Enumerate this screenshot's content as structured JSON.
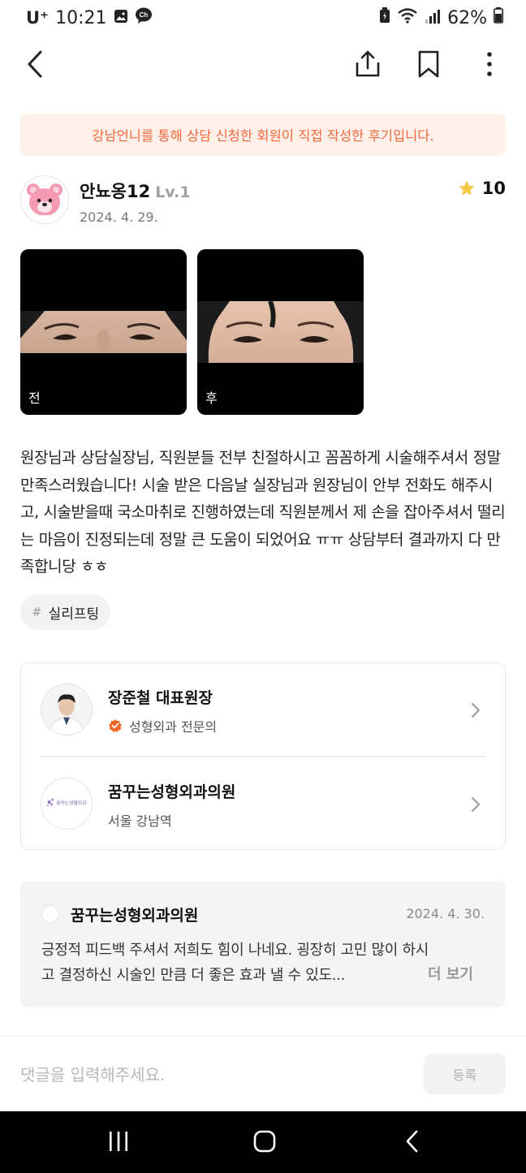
{
  "status_bar": {
    "carrier": "U⁺",
    "time": "10:21",
    "battery": "62%"
  },
  "notice": "강남언니를 통해 상담 신청한 회원이 직접 작성한 후기입니다.",
  "author": {
    "name": "안뇨옹12",
    "level": "Lv.1",
    "date": "2024. 4. 29.",
    "rating": "10"
  },
  "photos": [
    {
      "label": "전"
    },
    {
      "label": "후"
    }
  ],
  "review_text": "원장님과 상담실장님, 직원분들 전부 친절하시고 꼼꼼하게 시술해주셔서 정말 만족스러웠습니다! 시술 받은 다음날 실장님과 원장님이 안부 전화도 해주시고, 시술받을때 국소마취로 진행하였는데 직원분께서 제 손을 잡아주셔서 떨리는 마음이 진정되는데 정말 큰 도움이 되었어요 ㅠㅠ 상담부터 결과까지 다 만족합니당 ㅎㅎ",
  "tag": {
    "hash": "#",
    "label": "실리프팅"
  },
  "doctor": {
    "name": "장준철 대표원장",
    "specialty": "성형외과 전문의"
  },
  "clinic": {
    "name": "꿈꾸는성형외과의원",
    "location": "서울 강남역",
    "logo_text": "꿈꾸는성형외과"
  },
  "reply": {
    "name": "꿈꾸는성형외과의원",
    "date": "2024. 4. 30.",
    "body": "긍정적 피드백 주셔서 저희도 힘이 나네요. 굉장히 고민 많이 하시고 결정하신 시술인 만큼 더 좋은 효과 낼 수 있도...",
    "more": "더 보기"
  },
  "comment": {
    "placeholder": "댓글을 입력해주세요.",
    "submit": "등록"
  },
  "colors": {
    "accent": "#f1683c",
    "notice_bg": "#fff1ea",
    "star": "#f7c748",
    "verified": "#f26522"
  }
}
